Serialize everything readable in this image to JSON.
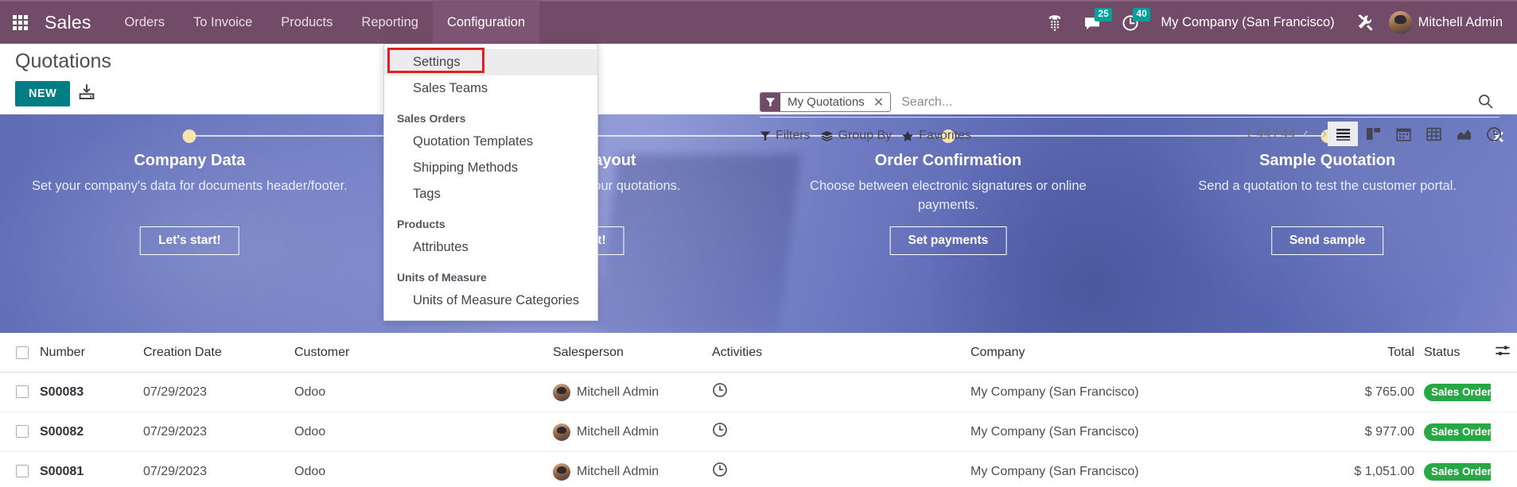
{
  "navbar": {
    "apps_icon": "grid-apps-icon",
    "brand": "Sales",
    "menu": [
      {
        "label": "Orders",
        "active": false
      },
      {
        "label": "To Invoice",
        "active": false
      },
      {
        "label": "Products",
        "active": false
      },
      {
        "label": "Reporting",
        "active": false
      },
      {
        "label": "Configuration",
        "active": true
      }
    ],
    "systray": {
      "dialpad_icon": "phone-dialpad-icon",
      "messages_icon": "chat-bubble-icon",
      "messages_count": "25",
      "activities_icon": "clock-icon",
      "activities_count": "40",
      "company": "My Company (San Francisco)",
      "debug_icon": "wrench-tools-icon",
      "avatar": "user-avatar",
      "user": "Mitchell Admin"
    },
    "colors": {
      "background": "#714b67",
      "active_item": "#7d5473",
      "badge": "#00a09d"
    }
  },
  "dropdown": {
    "open_for": "Configuration",
    "highlighted_item": "Settings",
    "highlight_color": "#e21e1e",
    "entries": [
      {
        "type": "item",
        "label": "Settings",
        "highlight": true
      },
      {
        "type": "item",
        "label": "Sales Teams",
        "highlight": false
      },
      {
        "type": "section",
        "label": "Sales Orders"
      },
      {
        "type": "item",
        "label": "Quotation Templates",
        "highlight": false
      },
      {
        "type": "item",
        "label": "Shipping Methods",
        "highlight": false
      },
      {
        "type": "item",
        "label": "Tags",
        "highlight": false
      },
      {
        "type": "section",
        "label": "Products"
      },
      {
        "type": "item",
        "label": "Attributes",
        "highlight": false
      },
      {
        "type": "section",
        "label": "Units of Measure"
      },
      {
        "type": "item",
        "label": "Units of Measure Categories",
        "highlight": false
      }
    ]
  },
  "control_panel": {
    "title": "Quotations",
    "new_label": "NEW",
    "export_icon": "export-download-icon",
    "search": {
      "facet_icon": "filter-funnel-icon",
      "facet_label": "My Quotations",
      "facet_remove_icon": "close-x-icon",
      "placeholder": "Search...",
      "value": "",
      "search_icon": "search-icon"
    },
    "buttons": [
      {
        "label": "Filters",
        "icon": "filter-funnel-icon"
      },
      {
        "label": "Group By",
        "icon": "layers-icon"
      },
      {
        "label": "Favorites",
        "icon": "star-icon"
      }
    ],
    "pager": {
      "range": "1-44 / 44",
      "prev_icon": "chevron-left-icon",
      "next_icon": "chevron-right-icon"
    },
    "views": [
      {
        "name": "list",
        "icon": "list-view-icon",
        "active": true
      },
      {
        "name": "kanban",
        "icon": "kanban-view-icon",
        "active": false
      },
      {
        "name": "calendar",
        "icon": "calendar-view-icon",
        "active": false
      },
      {
        "name": "pivot",
        "icon": "pivot-view-icon",
        "active": false
      },
      {
        "name": "graph",
        "icon": "graph-view-icon",
        "active": false
      },
      {
        "name": "activity",
        "icon": "activity-clock-view-icon",
        "active": false
      }
    ],
    "new_button_color": "#017e84"
  },
  "banner": {
    "close_icon": "close-x-icon",
    "steps": [
      {
        "title": "Company Data",
        "description": "Set your company's data for documents header/footer.",
        "button": "Let's start!"
      },
      {
        "title": "Document Layout",
        "description": "Customize the look of your quotations.",
        "button": "Looks great!"
      },
      {
        "title": "Order Confirmation",
        "description": "Choose between electronic signatures or online payments.",
        "button": "Set payments"
      },
      {
        "title": "Sample Quotation",
        "description": "Send a quotation to test the customer portal.",
        "button": "Send sample"
      }
    ]
  },
  "list": {
    "columns": [
      "Number",
      "Creation Date",
      "Customer",
      "Salesperson",
      "Activities",
      "Company",
      "Total",
      "Status"
    ],
    "optional_columns_icon": "column-options-icon",
    "select_all_checkbox": false,
    "rows": [
      {
        "number": "S00083",
        "creation_date": "07/29/2023",
        "customer": "Odoo",
        "salesperson": "Mitchell Admin",
        "activity_icon": "clock-icon",
        "company": "My Company (San Francisco)",
        "total": "$ 765.00",
        "status": "Sales Order"
      },
      {
        "number": "S00082",
        "creation_date": "07/29/2023",
        "customer": "Odoo",
        "salesperson": "Mitchell Admin",
        "activity_icon": "clock-icon",
        "company": "My Company (San Francisco)",
        "total": "$ 977.00",
        "status": "Sales Order"
      },
      {
        "number": "S00081",
        "creation_date": "07/29/2023",
        "customer": "Odoo",
        "salesperson": "Mitchell Admin",
        "activity_icon": "clock-icon",
        "company": "My Company (San Francisco)",
        "total": "$ 1,051.00",
        "status": "Sales Order"
      }
    ],
    "status_badge_color": "#28a745"
  }
}
